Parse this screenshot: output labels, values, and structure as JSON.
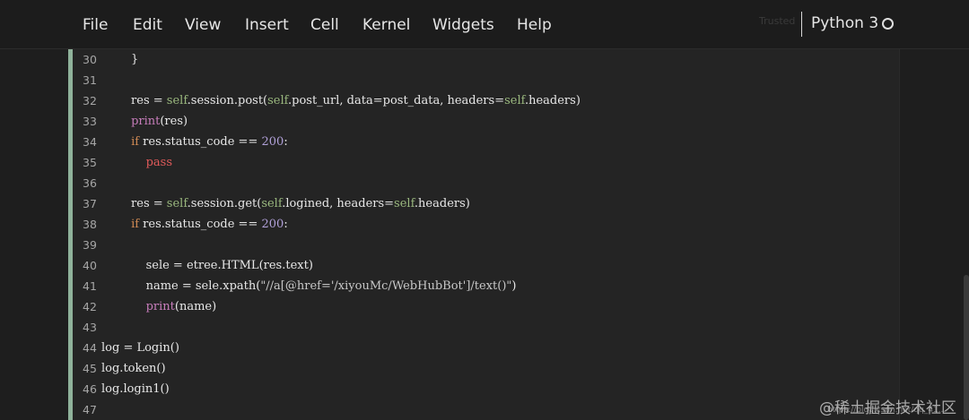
{
  "menu": {
    "items": [
      "File",
      "Edit",
      "View",
      "Insert",
      "Cell",
      "Kernel",
      "Widgets",
      "Help"
    ],
    "trusted_label": "Trusted",
    "kernel_name": "Python 3",
    "kernel_status_icon": "kernel-idle-circle-icon"
  },
  "cell": {
    "lines": [
      {
        "n": "30",
        "text": "        }"
      },
      {
        "n": "31",
        "text": ""
      },
      {
        "n": "32",
        "text": "        res = self.session.post(self.post_url, data=post_data, headers=self.headers)"
      },
      {
        "n": "33",
        "text": "        print(res)"
      },
      {
        "n": "34",
        "text": "        if res.status_code == 200:"
      },
      {
        "n": "35",
        "text": "            pass"
      },
      {
        "n": "36",
        "text": ""
      },
      {
        "n": "37",
        "text": "        res = self.session.get(self.logined, headers=self.headers)"
      },
      {
        "n": "38",
        "text": "        if res.status_code == 200:"
      },
      {
        "n": "39",
        "text": ""
      },
      {
        "n": "40",
        "text": "            sele = etree.HTML(res.text)"
      },
      {
        "n": "41",
        "text": "            name = sele.xpath(\"//a[@href='/xiyouMc/WebHubBot']/text()\")"
      },
      {
        "n": "42",
        "text": "            print(name)"
      },
      {
        "n": "43",
        "text": ""
      },
      {
        "n": "44",
        "text": "log = Login()"
      },
      {
        "n": "45",
        "text": "log.token()"
      },
      {
        "n": "46",
        "text": "log.login1()"
      },
      {
        "n": "47",
        "text": ""
      }
    ]
  },
  "watermark": {
    "text": "@稀土掘金技术社区",
    "url": "https://blog.csdn.net/qq_41..."
  },
  "colors": {
    "menubar_bg": "#1c1c1c",
    "cell_bg": "#242424",
    "cell_border": "#8fb29a",
    "keyword": "#d08a54",
    "self": "#9ab87e",
    "builtin": "#c77dbb",
    "number": "#b0a0d8",
    "pass": "#e05a5a"
  }
}
